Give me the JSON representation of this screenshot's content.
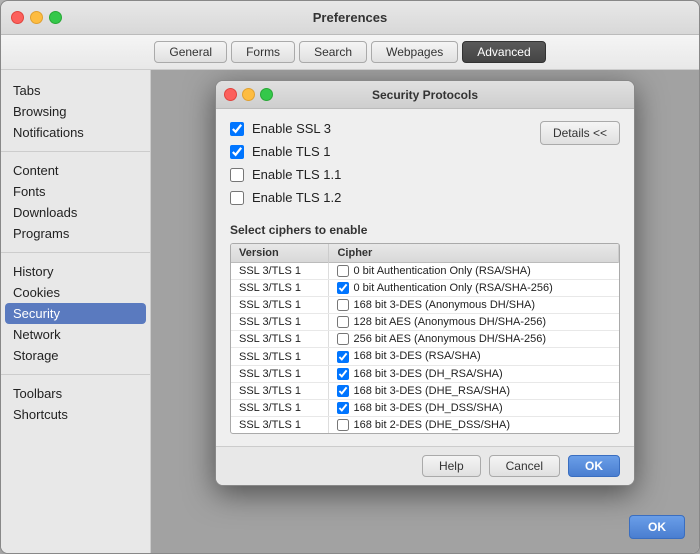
{
  "window": {
    "title": "Preferences"
  },
  "toolbar": {
    "tabs": [
      {
        "id": "general",
        "label": "General",
        "active": false
      },
      {
        "id": "forms",
        "label": "Forms",
        "active": false
      },
      {
        "id": "search",
        "label": "Search",
        "active": false
      },
      {
        "id": "webpages",
        "label": "Webpages",
        "active": false
      },
      {
        "id": "advanced",
        "label": "Advanced",
        "active": true
      }
    ]
  },
  "sidebar": {
    "sections": [
      {
        "items": [
          {
            "id": "tabs",
            "label": "Tabs",
            "selected": false
          },
          {
            "id": "browsing",
            "label": "Browsing",
            "selected": false
          },
          {
            "id": "notifications",
            "label": "Notifications",
            "selected": false
          }
        ]
      },
      {
        "items": [
          {
            "id": "content",
            "label": "Content",
            "selected": false
          },
          {
            "id": "fonts",
            "label": "Fonts",
            "selected": false
          },
          {
            "id": "downloads",
            "label": "Downloads",
            "selected": false
          },
          {
            "id": "programs",
            "label": "Programs",
            "selected": false
          }
        ]
      },
      {
        "items": [
          {
            "id": "history",
            "label": "History",
            "selected": false
          },
          {
            "id": "cookies",
            "label": "Cookies",
            "selected": false
          },
          {
            "id": "security",
            "label": "Security",
            "selected": true
          },
          {
            "id": "network",
            "label": "Network",
            "selected": false
          },
          {
            "id": "storage",
            "label": "Storage",
            "selected": false
          }
        ]
      },
      {
        "items": [
          {
            "id": "toolbars",
            "label": "Toolbars",
            "selected": false
          },
          {
            "id": "shortcuts",
            "label": "Shortcuts",
            "selected": false
          }
        ]
      }
    ]
  },
  "modal": {
    "title": "Security Protocols",
    "checkboxes": [
      {
        "id": "ssl3",
        "label": "Enable SSL 3",
        "checked": true
      },
      {
        "id": "tls1",
        "label": "Enable TLS 1",
        "checked": true
      },
      {
        "id": "tls11",
        "label": "Enable TLS 1.1",
        "checked": false
      },
      {
        "id": "tls12",
        "label": "Enable TLS 1.2",
        "checked": false
      }
    ],
    "details_button": "Details <<",
    "ciphers_label": "Select ciphers to enable",
    "cipher_table": {
      "headers": [
        "Version",
        "Cipher"
      ],
      "rows": [
        {
          "version": "SSL 3/TLS 1",
          "cipher": "0 bit Authentication Only (RSA/SHA)",
          "checked": false
        },
        {
          "version": "SSL 3/TLS 1",
          "cipher": "0 bit Authentication Only (RSA/SHA-256)",
          "checked": true
        },
        {
          "version": "SSL 3/TLS 1",
          "cipher": "168 bit 3-DES (Anonymous DH/SHA)",
          "checked": false
        },
        {
          "version": "SSL 3/TLS 1",
          "cipher": "128 bit AES (Anonymous DH/SHA-256)",
          "checked": false
        },
        {
          "version": "SSL 3/TLS 1",
          "cipher": "256 bit AES (Anonymous DH/SHA-256)",
          "checked": false
        },
        {
          "version": "SSL 3/TLS 1",
          "cipher": "168 bit 3-DES (RSA/SHA)",
          "checked": true
        },
        {
          "version": "SSL 3/TLS 1",
          "cipher": "168 bit 3-DES (DH_RSA/SHA)",
          "checked": true
        },
        {
          "version": "SSL 3/TLS 1",
          "cipher": "168 bit 3-DES (DHE_RSA/SHA)",
          "checked": true
        },
        {
          "version": "SSL 3/TLS 1",
          "cipher": "168 bit 3-DES (DH_DSS/SHA)",
          "checked": true
        },
        {
          "version": "SSL 3/TLS 1",
          "cipher": "168 bit 2-DES (DHE_DSS/SHA)",
          "checked": false
        }
      ]
    },
    "footer": {
      "help": "Help",
      "cancel": "Cancel",
      "ok": "OK"
    }
  },
  "main": {
    "ok_button": "OK"
  }
}
